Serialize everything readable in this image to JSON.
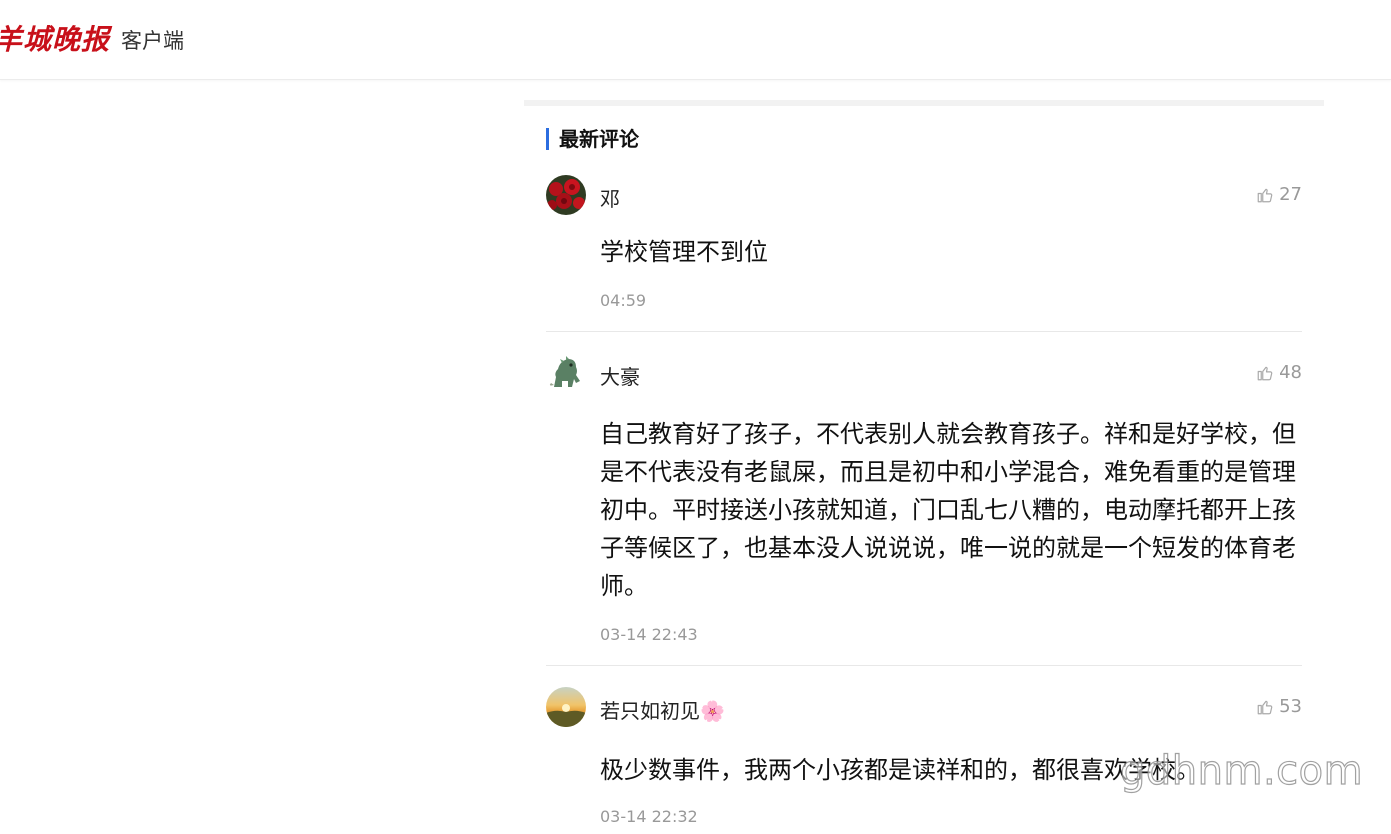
{
  "header": {
    "logo_text": "羊城晚报",
    "client_label": "客户端"
  },
  "section": {
    "title": "最新评论"
  },
  "comments": [
    {
      "username": "邓",
      "likes": "27",
      "text": "学校管理不到位",
      "time": "04:59",
      "avatar": "red-roses-avatar"
    },
    {
      "username": "大豪",
      "likes": "48",
      "text": "自己教育好了孩子，不代表别人就会教育孩子。祥和是好学校，但是不代表没有老鼠屎，而且是初中和小学混合，难免看重的是管理初中。平时接送小孩就知道，门口乱七八糟的，电动摩托都开上孩子等候区了，也基本没人说说说，唯一说的就是一个短发的体育老师。",
      "time": "03-14 22:43",
      "avatar": "green-dinosaur-avatar"
    },
    {
      "username": "若只如初见🌸",
      "likes": "53",
      "text": "极少数事件，我两个小孩都是读祥和的，都很喜欢学校。",
      "time": "03-14 22:32",
      "avatar": "sunset-landscape-avatar"
    }
  ],
  "watermark": "gdhnm.com",
  "colors": {
    "brand_red": "#c8101a",
    "accent_blue": "#2b6de0",
    "muted_gray": "#999999"
  }
}
